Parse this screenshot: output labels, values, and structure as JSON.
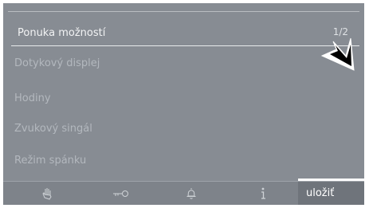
{
  "header": {
    "title": "Ponuka možností",
    "page": "1/2"
  },
  "menu": {
    "items": [
      {
        "label": "Dotykový displej"
      },
      {
        "label": "Hodiny"
      },
      {
        "label": "Zvukový singál"
      },
      {
        "label": "Režim spánku"
      }
    ]
  },
  "bottom_bar": {
    "icons": [
      "hand-touch-icon",
      "key-icon",
      "bell-icon",
      "info-icon"
    ],
    "save_label": "uložiť"
  },
  "colors": {
    "background": "#878c93",
    "text": "#f2f3f4",
    "accent": "#ffffff"
  }
}
